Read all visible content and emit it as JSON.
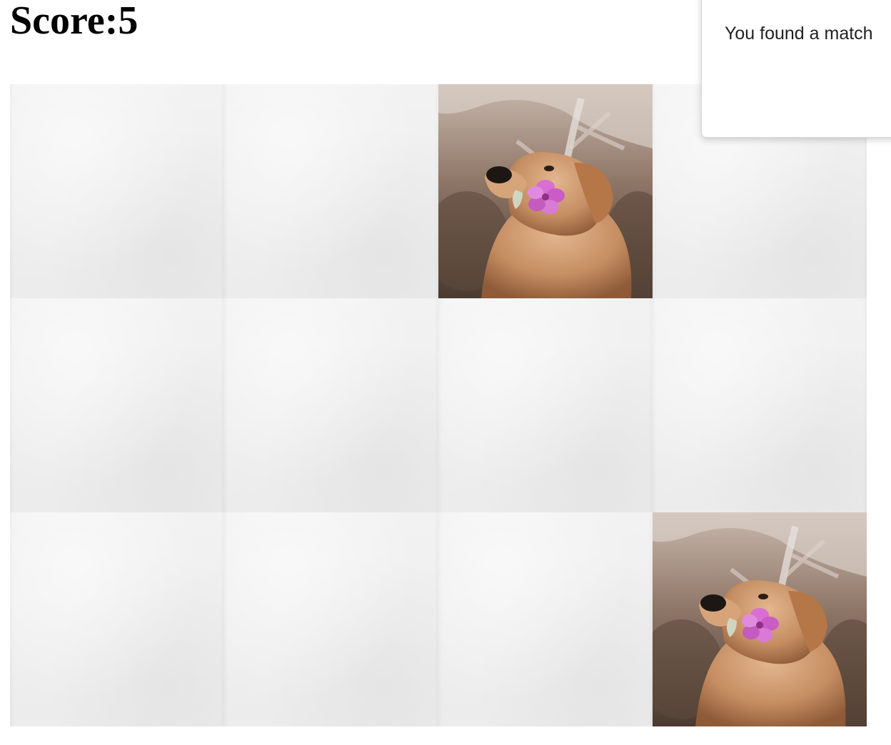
{
  "score": {
    "text": "Score:5",
    "value": 5
  },
  "board": {
    "rows": 3,
    "columns": 4,
    "cards": [
      {
        "state": "face-down"
      },
      {
        "state": "face-down"
      },
      {
        "state": "face-up",
        "image": "golden-retriever-with-flower"
      },
      {
        "state": "face-down"
      },
      {
        "state": "face-down"
      },
      {
        "state": "face-down"
      },
      {
        "state": "face-down"
      },
      {
        "state": "face-down"
      },
      {
        "state": "face-down"
      },
      {
        "state": "face-down"
      },
      {
        "state": "face-down"
      },
      {
        "state": "face-up",
        "image": "golden-retriever-with-flower"
      }
    ]
  },
  "toast": {
    "message": "You found a match"
  }
}
